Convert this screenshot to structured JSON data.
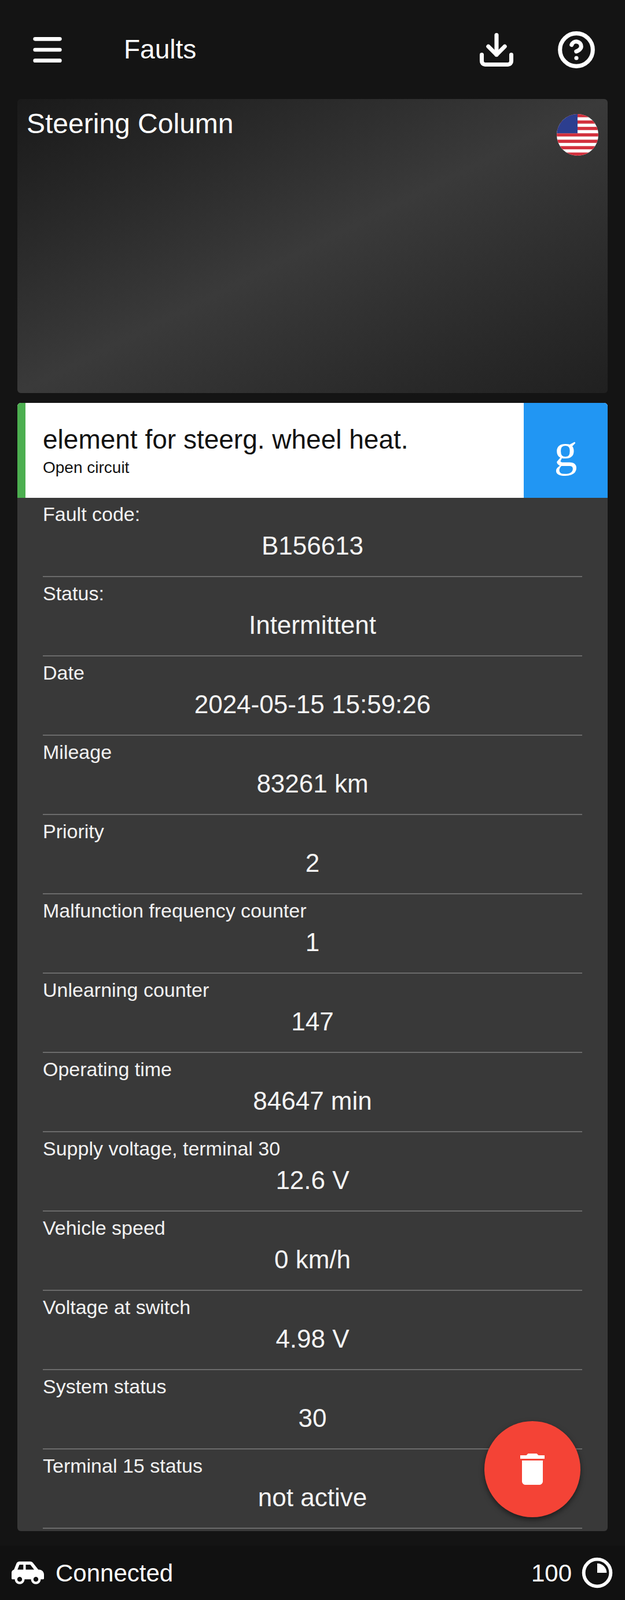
{
  "app_bar": {
    "title": "Faults"
  },
  "module": {
    "title": "Steering Column"
  },
  "fault": {
    "description": "element for steerg. wheel heat.",
    "detail": "Open circuit",
    "search_button": "g"
  },
  "fields": [
    {
      "label": "Fault code:",
      "value": "B156613"
    },
    {
      "label": "Status:",
      "value": "Intermittent"
    },
    {
      "label": "Date",
      "value": "2024-05-15 15:59:26"
    },
    {
      "label": "Mileage",
      "value": "83261 km"
    },
    {
      "label": "Priority",
      "value": "2"
    },
    {
      "label": "Malfunction frequency counter",
      "value": "1"
    },
    {
      "label": "Unlearning counter",
      "value": "147"
    },
    {
      "label": "Operating time",
      "value": "84647 min"
    },
    {
      "label": "Supply voltage, terminal 30",
      "value": "12.6 V"
    },
    {
      "label": "Vehicle speed",
      "value": "0 km/h"
    },
    {
      "label": "Voltage at switch",
      "value": "4.98 V"
    },
    {
      "label": "System status",
      "value": "30"
    },
    {
      "label": "Terminal 15 status",
      "value": "not active"
    }
  ],
  "status_bar": {
    "connection": "Connected",
    "value": "100"
  }
}
